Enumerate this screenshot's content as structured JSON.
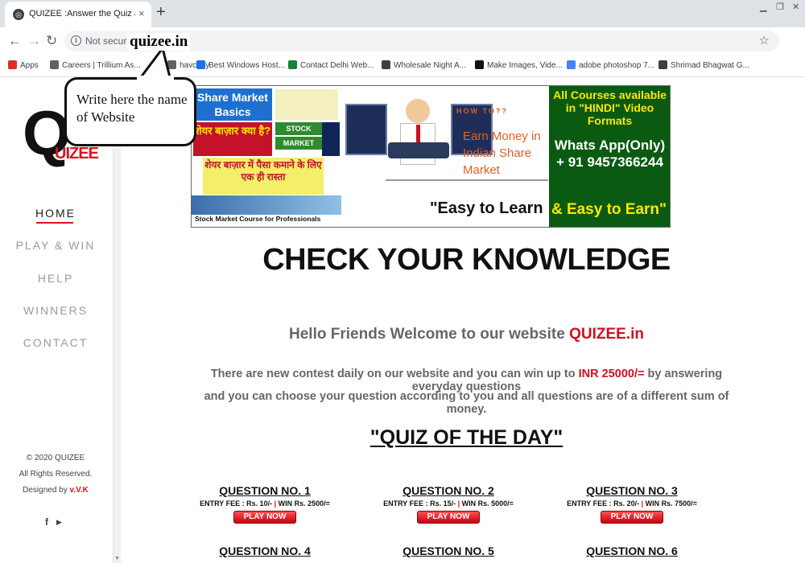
{
  "browser": {
    "tab_title": "QUIZEE :Answer the Quiz and Wi",
    "tab_close": "×",
    "new_tab": "+",
    "back": "←",
    "forward": "→",
    "reload": "↻",
    "url_status": "Not secure",
    "star": "☆",
    "bookmarks": [
      {
        "label": "Apps",
        "color": "#d93025"
      },
      {
        "label": "Careers | Trillium As...",
        "color": "#5f6368"
      },
      {
        "label": "havcopy",
        "color": "#5f6368"
      },
      {
        "label": "Best Windows Host...",
        "color": "#1a73e8"
      },
      {
        "label": "Contact Delhi Web...",
        "color": "#188038"
      },
      {
        "label": "Wholesale Night A...",
        "color": "#3c4043"
      },
      {
        "label": "Make Images, Vide...",
        "color": "#111111"
      },
      {
        "label": "adobe photoshop 7...",
        "color": "#4285f4"
      },
      {
        "label": "Shrimad Bhagwat G...",
        "color": "#3c4043"
      }
    ]
  },
  "callout": {
    "domain": "quizee.in",
    "text": "Write here the name of Website"
  },
  "logo": {
    "letter": "Q",
    "rest": "UIZEE"
  },
  "nav": [
    {
      "label": "HOME",
      "active": true
    },
    {
      "label": "PLAY & WIN"
    },
    {
      "label": "HELP"
    },
    {
      "label": "WINNERS"
    },
    {
      "label": "CONTACT"
    }
  ],
  "footer": {
    "copyright": "© 2020 QUIZEE",
    "rights": "All Rights Reserved.",
    "designed_prefix": "Designed by",
    "designer": "v.V.K",
    "social": [
      "f",
      "▶"
    ]
  },
  "banner": {
    "share_market": "Share Market Basics",
    "hindi_q": "शेयर बाज़ार क्या है?",
    "stock": "STOCK",
    "market": "MARKET",
    "hindi_way": "शेयर बाज़ार में पैसा कमाने के लिए एक ही रास्ता",
    "course": "Stock Market Course for Professionals",
    "how_to": "HOW TO??",
    "earn_money": "Earn Money in Indian Share Market",
    "easy_learn": "\"Easy to Learn",
    "courses": "All Courses available in \"HINDI\" Video Formats",
    "whatsapp": "Whats App(Only)",
    "phone": "+ 91 9457366244",
    "easy_earn": "& Easy to Earn\""
  },
  "headline": "CHECK YOUR KNOWLEDGE",
  "welcome": {
    "text": "Hello Friends Welcome to our website ",
    "brand": "QUIZEE.in"
  },
  "description": {
    "line1_a": "There are new contest daily on our website and you can win up to ",
    "line1_amount": "INR 25000/=",
    "line1_b": " by answering everyday questions",
    "line2": "and you can choose your question according to you and all questions are of a different sum of money."
  },
  "quiz_of_day": "\"QUIZ OF THE DAY\"",
  "questions": [
    {
      "title": "QUESTION NO. 1",
      "fee": "ENTRY FEE : Rs. 10/-",
      "sep": "|",
      "win": "WIN  Rs.   2500/=",
      "button": "PLAY NOW"
    },
    {
      "title": "QUESTION NO. 2",
      "fee": "ENTRY FEE : Rs. 15/-",
      "sep": "|",
      "win": "WIN  Rs.   5000/=",
      "button": "PLAY NOW"
    },
    {
      "title": "QUESTION NO. 3",
      "fee": "ENTRY FEE : Rs. 20/-",
      "sep": "|",
      "win": "WIN  Rs.   7500/=",
      "button": "PLAY NOW"
    },
    {
      "title": "QUESTION NO. 4"
    },
    {
      "title": "QUESTION NO. 5"
    },
    {
      "title": "QUESTION NO. 6"
    }
  ],
  "colors": {
    "accent": "#e0101c",
    "banner_green": "#0a5a12",
    "banner_yellow": "#ffe600"
  }
}
